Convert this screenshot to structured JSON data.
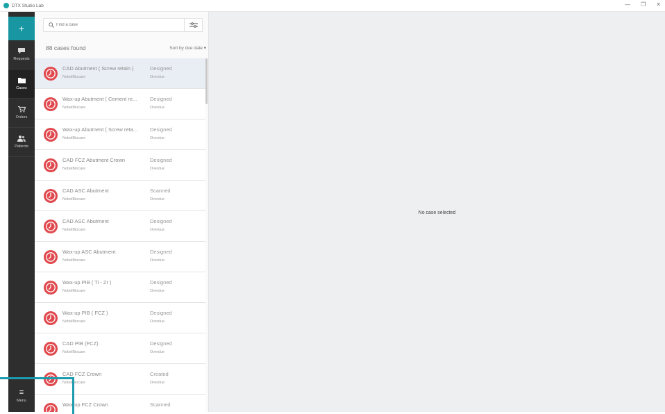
{
  "app": {
    "title": "DTX Studio Lab"
  },
  "window_controls": {
    "minimize": "—",
    "restore": "❐",
    "close": "✕"
  },
  "sidebar": {
    "new_label": "+",
    "items": [
      {
        "label": "Requests",
        "icon": "chat-bubble-icon"
      },
      {
        "label": "Cases",
        "icon": "folder-icon"
      },
      {
        "label": "Orders",
        "icon": "cart-icon"
      },
      {
        "label": "Patients",
        "icon": "people-icon"
      }
    ],
    "menu_label": "Menu",
    "menu_icon": "≡",
    "active": "Cases"
  },
  "search": {
    "placeholder": "Find a case"
  },
  "list": {
    "count_text": "88 cases found",
    "sort_label": "Sort by due date ▾",
    "cases": [
      {
        "name": "CAD Abutment ( Screw retain )",
        "vendor": "NobelBiocare",
        "status": "Designed",
        "due": "Overdue"
      },
      {
        "name": "Wax-up Abutment ( Cement re...",
        "vendor": "NobelBiocare",
        "status": "Designed",
        "due": "Overdue"
      },
      {
        "name": "Wax-up Abutment ( Screw reta...",
        "vendor": "NobelBiocare",
        "status": "Designed",
        "due": "Overdue"
      },
      {
        "name": "CAD FCZ Abutment Crown",
        "vendor": "NobelBiocare",
        "status": "Designed",
        "due": "Overdue"
      },
      {
        "name": "CAD ASC Abutment",
        "vendor": "NobelBiocare",
        "status": "Scanned",
        "due": "Overdue"
      },
      {
        "name": "CAD ASC Abutment",
        "vendor": "NobelBiocare",
        "status": "Designed",
        "due": "Overdue"
      },
      {
        "name": "Wax-up ASC Abutment",
        "vendor": "NobelBiocare",
        "status": "Designed",
        "due": "Overdue"
      },
      {
        "name": "Wax-up PIB ( Ti - Zr )",
        "vendor": "NobelBiocare",
        "status": "Designed",
        "due": "Overdue"
      },
      {
        "name": "Wax-up PIB ( FCZ )",
        "vendor": "NobelBiocare",
        "status": "Designed",
        "due": "Overdue"
      },
      {
        "name": "CAD PIB (FCZ)",
        "vendor": "NobelBiocare",
        "status": "Designed",
        "due": "Overdue"
      },
      {
        "name": "CAD FCZ Crown",
        "vendor": "NobelBiocare",
        "status": "Created",
        "due": "Overdue"
      },
      {
        "name": "Wax-up FCZ Crown",
        "vendor": "",
        "status": "Scanned",
        "due": ""
      }
    ],
    "selected_index": 0
  },
  "detail": {
    "empty_text": "No case selected"
  },
  "colors": {
    "accent": "#1897a3",
    "rail": "#2e2e2e",
    "overdue": "#e04a4f",
    "highlight": "#1d9bad"
  }
}
